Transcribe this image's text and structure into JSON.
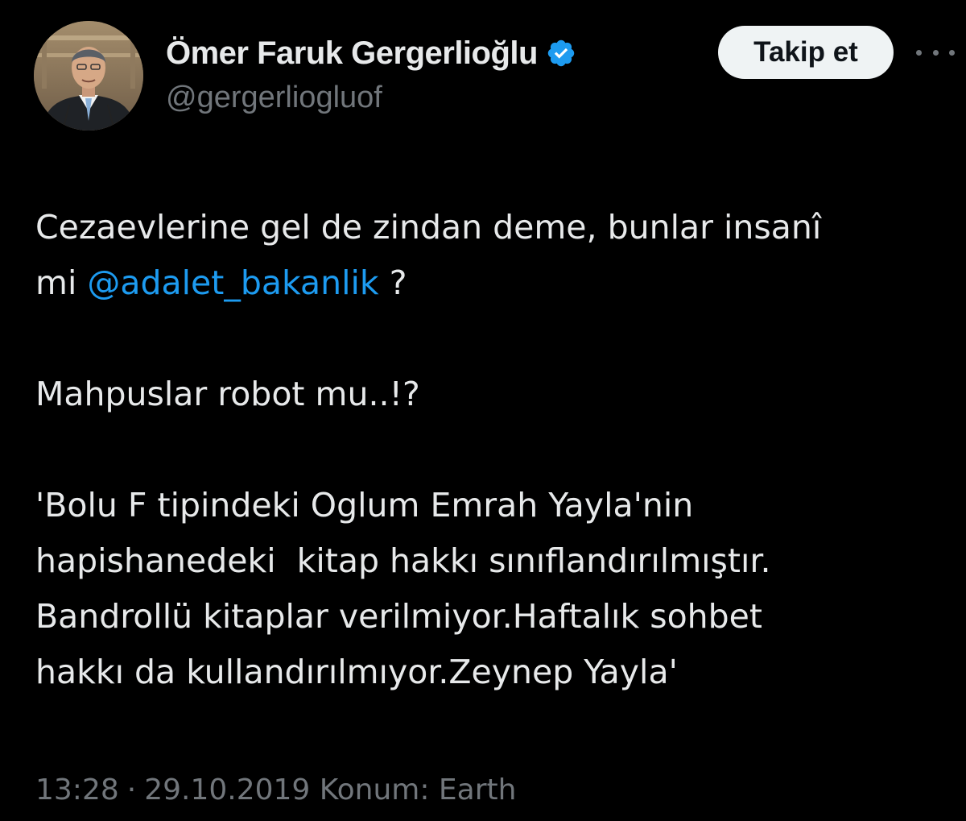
{
  "author": {
    "display_name": "Ömer Faruk Gergerlioğlu",
    "handle": "@gergerliogluof",
    "verified_icon": "verified-badge-icon",
    "avatar_icon": "profile-photo"
  },
  "actions": {
    "follow_label": "Takip et",
    "more_icon": "more-horizontal-icon"
  },
  "tweet": {
    "line1": "Cezaevlerine gel de zindan deme, bunlar insanî",
    "line2_prefix": "mi ",
    "mention": "@adalet_bakanlik",
    "line2_suffix": " ?",
    "line3": "Mahpuslar robot mu..!?",
    "line4": "'Bolu F tipindeki Oglum Emrah Yayla'nin",
    "line5": "hapishanedeki  kitap hakkı sınıflandırılmıştır.",
    "line6": "Bandrollü kitaplar verilmiyor.Haftalık sohbet",
    "line7": "hakkı da kullandırılmıyor.Zeynep Yayla'"
  },
  "meta": {
    "time": "13:28",
    "separator": "·",
    "date": "29.10.2019",
    "location": "Konum: Earth"
  },
  "colors": {
    "background": "#000000",
    "text": "#e7e9ea",
    "secondary": "#71767b",
    "accent": "#1d9bf0",
    "button_bg": "#eff3f4"
  }
}
